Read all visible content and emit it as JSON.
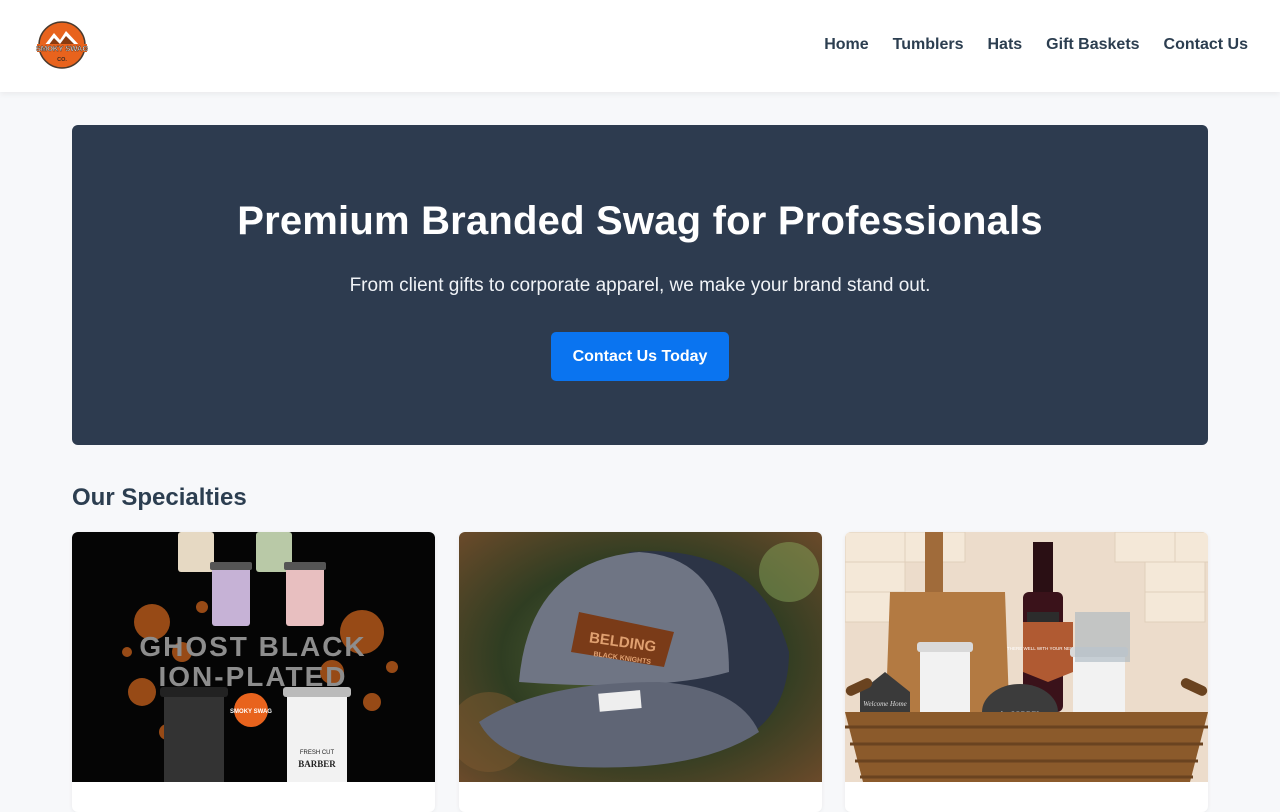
{
  "header": {
    "logo": {
      "text_top": "SMOKY SWAG",
      "text_bottom": "CO.",
      "icon": "mountain-logo"
    },
    "nav": [
      {
        "label": "Home"
      },
      {
        "label": "Tumblers"
      },
      {
        "label": "Hats"
      },
      {
        "label": "Gift Baskets"
      },
      {
        "label": "Contact Us"
      }
    ]
  },
  "hero": {
    "title": "Premium Branded Swag for Professionals",
    "subtitle": "From client gifts to corporate apparel, we make your brand stand out.",
    "cta_label": "Contact Us Today"
  },
  "specialties": {
    "title": "Our Specialties",
    "cards": [
      {
        "image": "tumblers-photo",
        "overlay_line1": "GHOST BLACK",
        "overlay_line2": "ION-PLATED",
        "badge": "SMOKY SWAG",
        "cup_text_1": "BARBER",
        "cup_text_2": "FRESH CUT"
      },
      {
        "image": "hat-photo",
        "patch_line1": "BELDING",
        "patch_line2": "BLACK KNIGHTS"
      },
      {
        "image": "gift-basket-photo",
        "tag_text": "THERE WELL WITH YOUR NEW HOME",
        "sign_text": "Welcome Home",
        "stone_text": "the SORREL"
      }
    ]
  },
  "colors": {
    "hero_bg": "#2d3b4f",
    "cta": "#0a74f0",
    "text_dark": "#2c3e50",
    "logo_orange": "#e8631d"
  }
}
